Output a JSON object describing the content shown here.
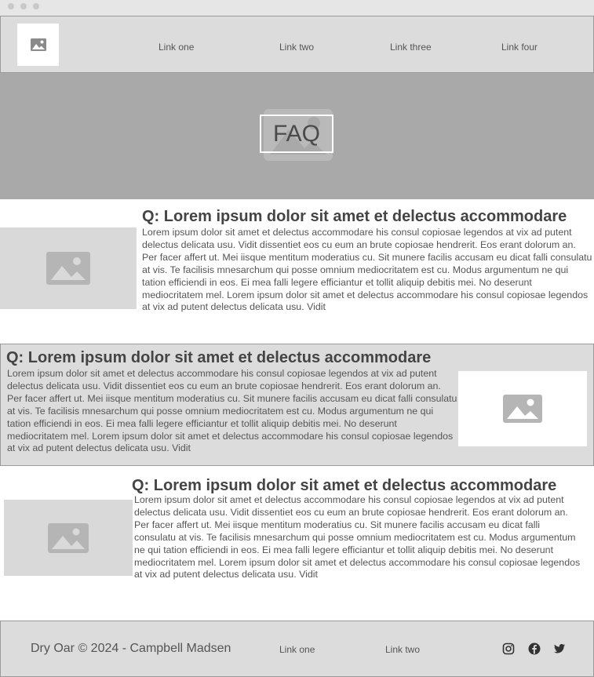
{
  "colors": {
    "header_bg": "#dcdcdc",
    "hero_bg": "#a9a9a9",
    "placeholder_bg": "#d9d9d9",
    "placeholder_icon": "#b5b5b5",
    "text": "#444444"
  },
  "header": {
    "logo_icon": "image-placeholder-icon",
    "nav": [
      {
        "label": "Link one"
      },
      {
        "label": "Link two"
      },
      {
        "label": "Link three"
      },
      {
        "label": "Link four"
      }
    ]
  },
  "hero": {
    "title": "FAQ",
    "background_icon": "image-placeholder-icon"
  },
  "faqs": [
    {
      "question": "Q: Lorem ipsum dolor sit amet et delectus accommodare",
      "answer": "Lorem ipsum dolor sit amet et delectus accommodare his consul copiosae legendos at vix ad putent delectus delicata usu. Vidit dissentiet eos cu eum an brute copiosae hendrerit. Eos erant dolorum an. Per facer affert ut. Mei iisque mentitum moderatius cu. Sit munere facilis accusam eu dicat falli consulatu at vis. Te facilisis mnesarchum qui posse omnium mediocritatem est cu. Modus argumentum ne qui tation efficiendi in eos. Ei mea falli legere efficiantur et tollit aliquip debitis mei. No deserunt mediocritatem mel. Lorem ipsum dolor sit amet et delectus accommodare his consul copiosae legendos at vix ad putent delectus delicata usu. Vidit",
      "image_icon": "image-placeholder-icon"
    },
    {
      "question": "Q: Lorem ipsum dolor sit amet et delectus accommodare",
      "answer": "Lorem ipsum dolor sit amet et delectus accommodare his consul copiosae legendos at vix ad putent delectus delicata usu. Vidit dissentiet eos cu eum an brute copiosae hendrerit. Eos erant dolorum an. Per facer affert ut. Mei iisque mentitum moderatius cu. Sit munere facilis accusam eu dicat falli consulatu at vis. Te facilisis mnesarchum qui posse omnium mediocritatem est cu. Modus argumentum ne qui tation efficiendi in eos. Ei mea falli legere efficiantur et tollit aliquip debitis mei. No deserunt mediocritatem mel. Lorem ipsum dolor sit amet et delectus accommodare his consul copiosae legendos at vix ad putent delectus delicata usu. Vidit",
      "image_icon": "image-placeholder-icon"
    },
    {
      "question": "Q: Lorem ipsum dolor sit amet et delectus accommodare",
      "answer": "Lorem ipsum dolor sit amet et delectus accommodare his consul copiosae legendos at vix ad putent delectus delicata usu. Vidit dissentiet eos cu eum an brute copiosae hendrerit. Eos erant dolorum an. Per facer affert ut. Mei iisque mentitum moderatius cu. Sit munere facilis accusam eu dicat falli consulatu at vis. Te facilisis mnesarchum qui posse omnium mediocritatem est cu. Modus argumentum ne qui tation efficiendi in eos. Ei mea falli legere efficiantur et tollit aliquip debitis mei. No deserunt mediocritatem mel. Lorem ipsum dolor sit amet et delectus accommodare his consul copiosae legendos at vix ad putent delectus delicata usu. Vidit",
      "image_icon": "image-placeholder-icon"
    }
  ],
  "footer": {
    "copyright": "Dry Oar © 2024 - Campbell Madsen",
    "links": [
      {
        "label": "Link one"
      },
      {
        "label": "Link two"
      }
    ],
    "social_icons": [
      "instagram-icon",
      "facebook-icon",
      "twitter-icon"
    ]
  }
}
